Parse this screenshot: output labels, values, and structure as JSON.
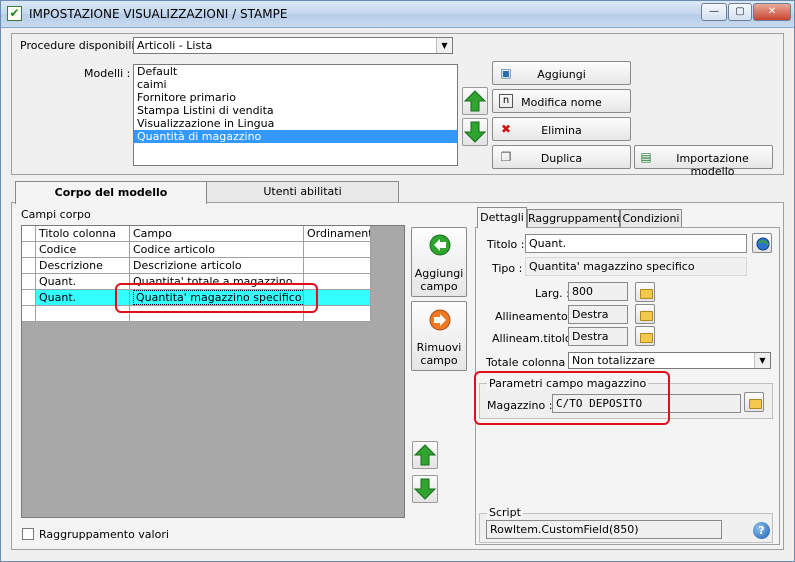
{
  "window": {
    "title": "IMPOSTAZIONE VISUALIZZAZIONI / STAMPE"
  },
  "procedure": {
    "label": "Procedure disponibili :",
    "value": "Articoli - Lista"
  },
  "modelli": {
    "label": "Modelli :",
    "items": [
      "Default",
      "caimi",
      "Fornitore primario",
      "Stampa Listini di vendita",
      "Visualizzazione in Lingua",
      "Quantità di magazzino"
    ],
    "selected_index": 5
  },
  "buttons": {
    "aggiungi": "Aggiungi",
    "modifica_nome": "Modifica nome",
    "elimina": "Elimina",
    "duplica": "Duplica",
    "importazione": "Importazione modello",
    "aggiungi_campo_1": "Aggiungi",
    "aggiungi_campo_2": "campo",
    "rimuovi_campo_1": "Rimuovi",
    "rimuovi_campo_2": "campo"
  },
  "tabs": {
    "corpo": "Corpo del modello",
    "utenti": "Utenti abilitati"
  },
  "campi_corpo": {
    "label": "Campi corpo",
    "headers": [
      "Titolo colonna",
      "Campo",
      "Ordinamento"
    ],
    "rows": [
      [
        "Codice",
        "Codice articolo",
        ""
      ],
      [
        "Descrizione",
        "Descrizione articolo",
        ""
      ],
      [
        "Quant.",
        "Quantita' totale a magazzino",
        ""
      ],
      [
        "Quant.",
        "Quantita' magazzino specifico",
        ""
      ]
    ]
  },
  "detail_tabs": {
    "dettagli": "Dettagli",
    "raggruppamento": "Raggruppamento",
    "condizioni": "Condizioni"
  },
  "dettagli": {
    "titolo_label": "Titolo :",
    "titolo_value": "Quant.",
    "tipo_label": "Tipo :",
    "tipo_value": "Quantita' magazzino specifico",
    "larg_label": "Larg. :",
    "larg_value": "800",
    "allineamento_label": "Allineamento :",
    "allineamento_value": "Destra",
    "allineam_titolo_label": "Allineam.titolo :",
    "allineam_titolo_value": "Destra",
    "totale_label": "Totale colonna :",
    "totale_value": "Non totalizzare"
  },
  "parametri": {
    "group_label": "Parametri campo magazzino",
    "magazzino_label": "Magazzino :",
    "magazzino_value": "C/TO DEPOSITO"
  },
  "script": {
    "group_label": "Script",
    "value": "RowItem.CustomField(850)"
  },
  "raggruppamento_valori": {
    "label": "Raggruppamento valori",
    "checked": false
  },
  "colors": {
    "selection": "#3399ff",
    "row_highlight": "#33ffff",
    "annotation": "#e0101a",
    "arrow_green": "#2fa52f",
    "arrow_orange": "#f07a20"
  }
}
